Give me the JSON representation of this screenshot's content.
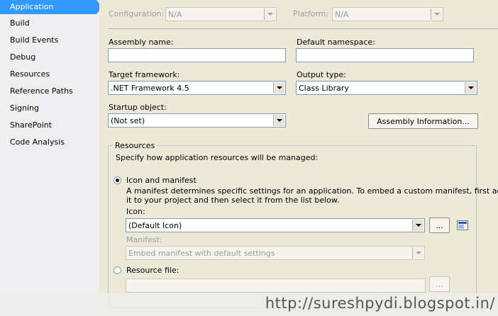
{
  "sidebar": {
    "items": [
      {
        "label": "Application",
        "active": true
      },
      {
        "label": "Build"
      },
      {
        "label": "Build Events"
      },
      {
        "label": "Debug"
      },
      {
        "label": "Resources"
      },
      {
        "label": "Reference Paths"
      },
      {
        "label": "Signing"
      },
      {
        "label": "SharePoint"
      },
      {
        "label": "Code Analysis"
      }
    ]
  },
  "config": {
    "configuration_label": "Configuration:",
    "configuration_value": "N/A",
    "platform_label": "Platform:",
    "platform_value": "N/A"
  },
  "form": {
    "assembly_name_label": "Assembly name:",
    "assembly_name_value": "",
    "default_namespace_label": "Default namespace:",
    "default_namespace_value": "",
    "target_framework_label": "Target framework:",
    "target_framework_value": ".NET Framework 4.5",
    "output_type_label": "Output type:",
    "output_type_value": "Class Library",
    "startup_object_label": "Startup object:",
    "startup_object_value": "(Not set)",
    "assembly_info_button": "Assembly Information..."
  },
  "resources": {
    "group_title": "Resources",
    "description": "Specify how application resources will be managed:",
    "icon_manifest_label": "Icon and manifest",
    "icon_manifest_desc_line1": "A manifest determines specific settings for an application. To embed a custom manifest, first add",
    "icon_manifest_desc_line2": "it to your project and then select it from the list below.",
    "icon_label": "Icon:",
    "icon_value": "(Default Icon)",
    "browse_label": "...",
    "manifest_label": "Manifest:",
    "manifest_value": "Embed manifest with default settings",
    "resource_file_label": "Resource file:",
    "resource_file_value": ""
  },
  "watermark": "http://sureshpydi.blogspot.in/"
}
